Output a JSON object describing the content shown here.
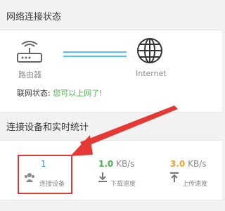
{
  "network": {
    "header": "网络连接状态",
    "router_label": "路由器",
    "internet_label": "Internet",
    "status_key": "联网状态: ",
    "status_value": "您可以上网了!"
  },
  "stats": {
    "header": "连接设备和实时统计",
    "devices": {
      "value": "1",
      "label": "连接设备"
    },
    "download": {
      "value": "1.0",
      "unit": " KB/s",
      "label": "下载速度"
    },
    "upload": {
      "value": "3.0",
      "unit": " KB/s",
      "label": "上传速度"
    }
  },
  "colors": {
    "accent_blue": "#3b8fd8",
    "download_green": "#4caf50",
    "upload_orange": "#f0a030",
    "annotation_red": "#e53935",
    "link_line": "#4fc3f7"
  },
  "icons": [
    "router-icon",
    "globe-icon",
    "devices-icon",
    "download-icon",
    "upload-icon",
    "annotation-arrow"
  ]
}
